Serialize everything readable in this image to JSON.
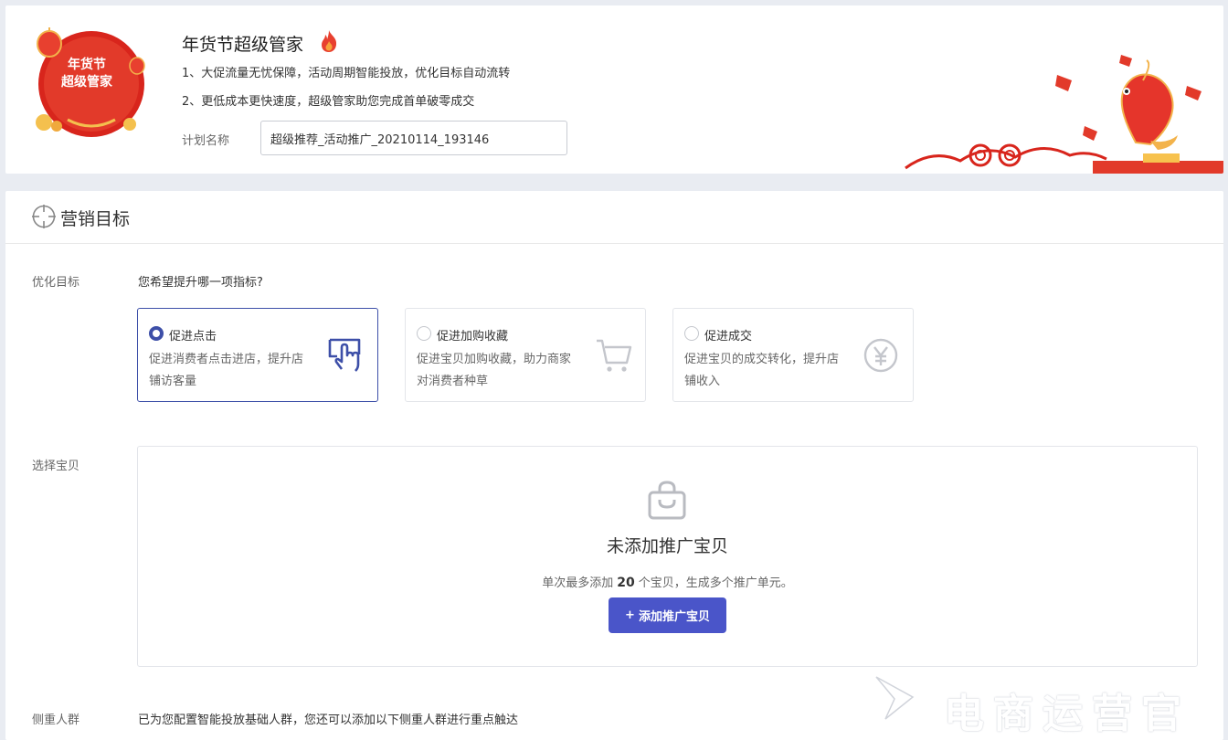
{
  "banner": {
    "badge_text_line1": "年货节",
    "badge_text_line2": "超级管家",
    "title": "年货节超级管家",
    "line1": "1、大促流量无忧保障，活动周期智能投放，优化目标自动流转",
    "line2": "2、更低成本更快速度，超级管家助您完成首单破零成交",
    "plan_label": "计划名称",
    "plan_value": "超级推荐_活动推广_20210114_193146"
  },
  "section": {
    "title": "营销目标"
  },
  "goal": {
    "label": "优化目标",
    "question": "您希望提升哪一项指标?",
    "options": [
      {
        "title": "促进点击",
        "desc": "促进消费者点击进店，提升店铺访客量",
        "selected": true,
        "icon": "hand-click-icon"
      },
      {
        "title": "促进加购收藏",
        "desc": "促进宝贝加购收藏，助力商家对消费者种草",
        "selected": false,
        "icon": "cart-icon"
      },
      {
        "title": "促进成交",
        "desc": "促进宝贝的成交转化，提升店铺收入",
        "selected": false,
        "icon": "yuan-icon"
      }
    ]
  },
  "product": {
    "label": "选择宝贝",
    "empty_title": "未添加推广宝贝",
    "empty_sub_prefix": "单次最多添加",
    "empty_sub_count": "20",
    "empty_sub_suffix": "个宝贝，生成多个推广单元。",
    "add_button": "添加推广宝贝"
  },
  "audience": {
    "label": "侧重人群",
    "desc": "已为您配置智能投放基础人群，您还可以添加以下侧重人群进行重点触达"
  },
  "watermark": {
    "text": "电商运营官"
  },
  "colors": {
    "accent": "#3d4fa8",
    "button": "#4a55c9",
    "festive_red": "#d8251c"
  }
}
